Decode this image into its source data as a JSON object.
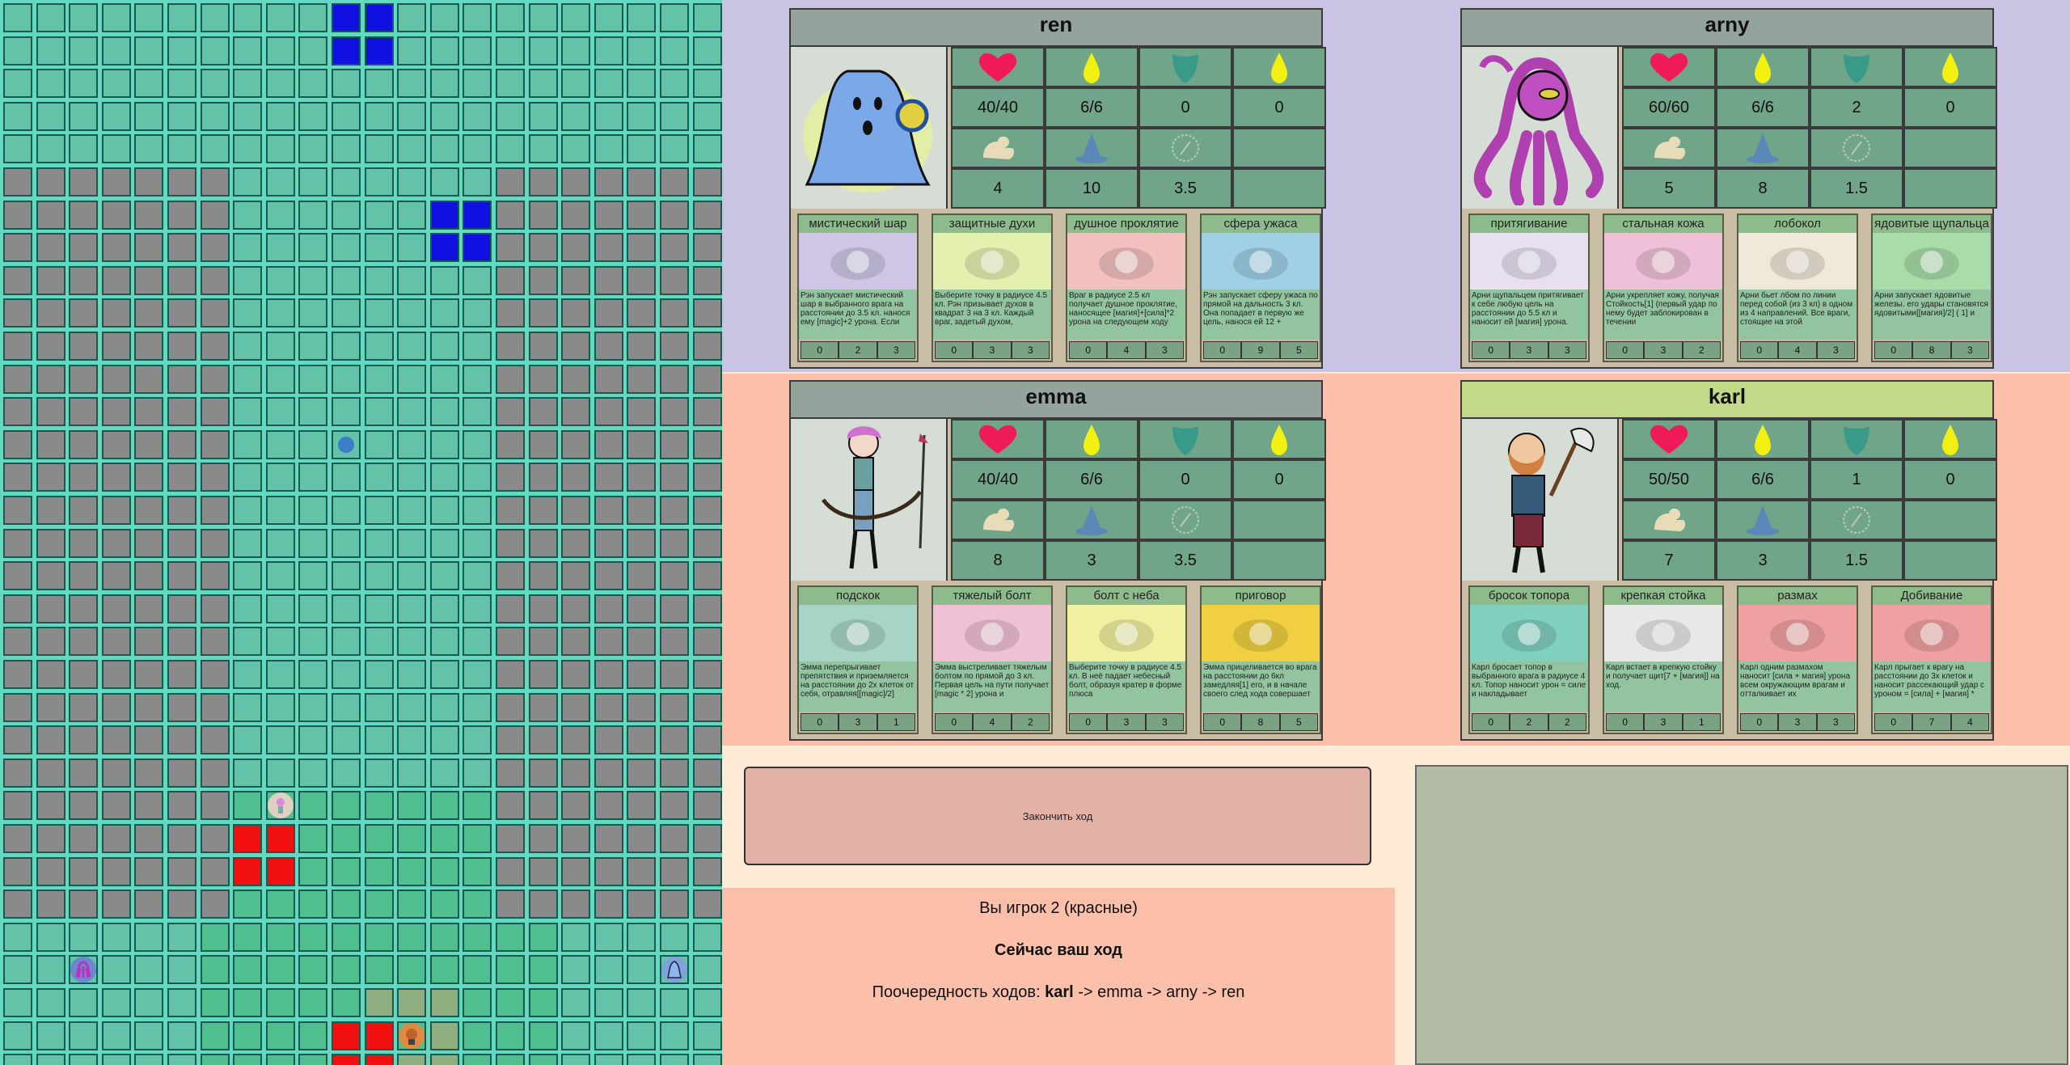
{
  "game": {
    "end_turn_label": "Закончить ход",
    "player_text": "Вы игрок 2 (красные)",
    "turn_text": "Сейчас ваш ход",
    "order_prefix": "Поочередность ходов:",
    "order_first": "karl",
    "order_rest": "-> emma -> arny -> ren"
  },
  "board": {
    "cols": 22,
    "rows": 33,
    "colors": {
      "teal": "#63c3a9",
      "grey": "#8a8a8a",
      "dark_teal": "#4fbf8f",
      "blue": "#1010e0",
      "red": "#f01010",
      "olive": "#8fae80"
    }
  },
  "heroes": [
    {
      "name": "ren",
      "health": "40/40",
      "mana": "6/6",
      "armor": "0",
      "mana_bonus": "0",
      "strength": "4",
      "magic": "10",
      "movement": "3.5",
      "icon": "ghost-portrait",
      "abilities": [
        {
          "title": "мистический шар",
          "desc": "Рэн запускает мистический шар в выбранного врага на расстоянии до 3.5 кл. нанося ему [magic]+2 урона. Если",
          "nums": [
            "0",
            "2",
            "3"
          ],
          "color": "#cfc6e6"
        },
        {
          "title": "защитные духи",
          "desc": "Выберите точку в радиусе 4.5 кл. Рэн призывает духов в квадрат 3 на 3 кл. Каждый враг, задетый духом,",
          "nums": [
            "0",
            "3",
            "3"
          ],
          "color": "#e4f0b0"
        },
        {
          "title": "душное проклятие",
          "desc": "Враг в радиусе 2.5 кл получает душное проклятие, наносящее [магия]+[сила]*2 урона на следующем ходу",
          "nums": [
            "0",
            "4",
            "3"
          ],
          "color": "#f3c0c0"
        },
        {
          "title": "сфера ужаса",
          "desc": "Рэн запускает сферу ужаса по прямой на дальность 3 кл. Она попадает в первую же цель, нанося ей 12 +",
          "nums": [
            "0",
            "9",
            "5"
          ],
          "color": "#9fd0e6"
        }
      ]
    },
    {
      "name": "arny",
      "health": "60/60",
      "mana": "6/6",
      "armor": "2",
      "mana_bonus": "0",
      "strength": "5",
      "magic": "8",
      "movement": "1.5",
      "icon": "tentacle-monster-portrait",
      "abilities": [
        {
          "title": "притягивание",
          "desc": "Арни щупальцем притягивает к себе любую цель на расстоянии до 5.5 кл и наносит ей [магия] урона.",
          "nums": [
            "0",
            "3",
            "3"
          ],
          "color": "#e8e0f0"
        },
        {
          "title": "стальная кожа",
          "desc": "Арни укрепляет кожу, получая Стойкость[1] (первый удар по нему будет заблокирован в течении",
          "nums": [
            "0",
            "3",
            "2"
          ],
          "color": "#f0c0d8"
        },
        {
          "title": "лобокол",
          "desc": "Арни бьет лбом по линии перед собой (из 3 кл) в одном из 4 направлений. Все враги, стоящие на этой",
          "nums": [
            "0",
            "4",
            "3"
          ],
          "color": "#f0e8d8"
        },
        {
          "title": "ядовитые щупальца",
          "desc": "Арни запускает ядовитые железы. его удары становятся ядовитыми[[магия]/2] ( 1] и",
          "nums": [
            "0",
            "8",
            "3"
          ],
          "color": "#a8dca8"
        }
      ]
    },
    {
      "name": "emma",
      "health": "40/40",
      "mana": "6/6",
      "armor": "0",
      "mana_bonus": "0",
      "strength": "8",
      "magic": "3",
      "movement": "3.5",
      "icon": "archer-portrait",
      "abilities": [
        {
          "title": "подскок",
          "desc": "Эмма перепрыгивает препятствия и приземляется на расстоянии до 2х клеток от себя, отравляя[[magic]/2]",
          "nums": [
            "0",
            "3",
            "1"
          ],
          "color": "#a8d4c8"
        },
        {
          "title": "тяжелый болт",
          "desc": "Эмма выстреливает тяжелым болтом по прямой до 3 кл. Первая цель на пути получает [magic * 2] урона и",
          "nums": [
            "0",
            "4",
            "2"
          ],
          "color": "#f0c0d4"
        },
        {
          "title": "болт с неба",
          "desc": "Выберите точку в радиусе 4.5 кл. В неё падает небесный болт, образуя кратер в форме плюса",
          "nums": [
            "0",
            "3",
            "3"
          ],
          "color": "#f0f0a0"
        },
        {
          "title": "приговор",
          "desc": "Эмма прицеливается во врага на расстоянии до 6кл замедляя[1] его, и в начале своего след хода совершает",
          "nums": [
            "0",
            "8",
            "5"
          ],
          "color": "#f0d040"
        }
      ]
    },
    {
      "name": "karl",
      "health": "50/50",
      "mana": "6/6",
      "armor": "1",
      "mana_bonus": "0",
      "strength": "7",
      "magic": "3",
      "movement": "1.5",
      "icon": "axeman-portrait",
      "abilities": [
        {
          "title": "бросок топора",
          "desc": "Карл бросает топор в выбранного врага в радиусе 4 кл. Топор наносит урон = силе и накладывает",
          "nums": [
            "0",
            "2",
            "2"
          ],
          "color": "#80d0c0"
        },
        {
          "title": "крепкая стойка",
          "desc": "Карл встает в крепкую стойку и получает щит[7 + [магия]] на ход.",
          "nums": [
            "0",
            "3",
            "1"
          ],
          "color": "#e8e8e8"
        },
        {
          "title": "размах",
          "desc": "Карл одним размахом наносит [сила + магия] урона всем окружающим врагам и отталкивает их",
          "nums": [
            "0",
            "3",
            "3"
          ],
          "color": "#f0a0a0"
        },
        {
          "title": "Добивание",
          "desc": "Карл прыгает к врагу на расстоянии до 3х клеток и наносит рассекающий удар с уроном = [сила] + [магия] *",
          "nums": [
            "0",
            "7",
            "4"
          ],
          "color": "#f0a0a0"
        }
      ]
    }
  ]
}
